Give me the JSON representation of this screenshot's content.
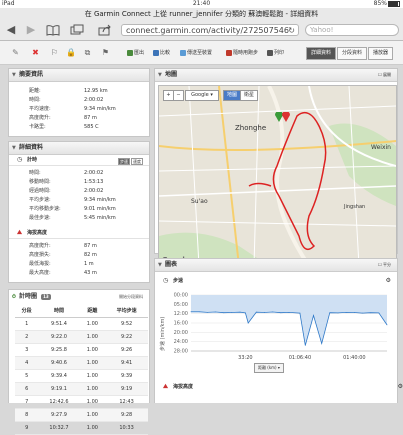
{
  "status": {
    "device": "iPad",
    "time": "21:40",
    "battery": "85%"
  },
  "page_title": "在 Garmin Connect 上從 runner_jennifer 分類的 蘇澳輕鬆跑 - 詳細資料",
  "url": "connect.garmin.com/activity/272507546",
  "search_placeholder": "Yahoo!",
  "toolbar": {
    "export": "匯出",
    "compare": "比較",
    "send_device": "傳送至裝置",
    "garmin_connect": "隨時用跑步",
    "print": "列印",
    "tabs": [
      "詳細資料",
      "分段資料",
      "播放器"
    ]
  },
  "overview": {
    "title": "摘要資訊",
    "rows": [
      {
        "k": "距離:",
        "v": "12.95 km"
      },
      {
        "k": "時間:",
        "v": "2:00:02"
      },
      {
        "k": "平均速度:",
        "v": "9:34 min/km"
      },
      {
        "k": "高度爬升:",
        "v": "87 m"
      },
      {
        "k": "卡路里:",
        "v": "585 C"
      }
    ]
  },
  "details": {
    "title": "詳細資料",
    "timing_title": "計時",
    "timing_opts": [
      "步速",
      "速度"
    ],
    "timing_rows": [
      {
        "k": "時間:",
        "v": "2:00:02"
      },
      {
        "k": "移動時間:",
        "v": "1:53:13"
      },
      {
        "k": "經過時間:",
        "v": "2:00:02"
      },
      {
        "k": "平均步速:",
        "v": "9:34 min/km"
      },
      {
        "k": "平均移動步速:",
        "v": "9:01 min/km"
      },
      {
        "k": "最佳步速:",
        "v": "5:45 min/km"
      }
    ],
    "elev_title": "海拔高度",
    "elev_rows": [
      {
        "k": "高度爬升:",
        "v": "87 m"
      },
      {
        "k": "高度損失:",
        "v": "82 m"
      },
      {
        "k": "最低海拔:",
        "v": "1 m"
      },
      {
        "k": "最大高度:",
        "v": "43 m"
      }
    ]
  },
  "laps": {
    "title": "計時圈",
    "count": "13",
    "link": "開始分段資料",
    "headers": [
      "分段",
      "時間",
      "距離",
      "平均步速"
    ],
    "rows": [
      [
        "1",
        "9:51.4",
        "1.00",
        "9:52"
      ],
      [
        "2",
        "9:22.0",
        "1.00",
        "9:22"
      ],
      [
        "3",
        "9:25.8",
        "1.00",
        "9:26"
      ],
      [
        "4",
        "9:40.6",
        "1.00",
        "9:41"
      ],
      [
        "5",
        "9:39.4",
        "1.00",
        "9:39"
      ],
      [
        "6",
        "9:19.1",
        "1.00",
        "9:19"
      ],
      [
        "7",
        "12:42.6",
        "1.00",
        "12:43"
      ],
      [
        "8",
        "9:27.9",
        "1.00",
        "9:28"
      ],
      [
        "9",
        "10:32.7",
        "1.00",
        "10:33"
      ]
    ]
  },
  "map": {
    "title": "地圖",
    "expand": "展開",
    "provider": "Google",
    "map_btn": "地圖",
    "sat_btn": "衛星",
    "labels": [
      "Zhonghe",
      "Su'ao",
      "Jingshan",
      "Weixin"
    ],
    "footer": "Map data ©2013 Google - Terms of Use"
  },
  "charts": {
    "title": "圖表",
    "lock_label": "平分",
    "pace_title": "步速",
    "yaxis_label": "步速 (min/km)",
    "x_button": "距離 (km)",
    "elev_title": "海拔高度",
    "pace_color": "#2f79c8",
    "chart_data": {
      "type": "line",
      "title": "步速",
      "ylabel": "步速 (min/km)",
      "yticks": [
        "00:00",
        "05:00",
        "12:00",
        "16:00",
        "20:00",
        "24:00",
        "28:00"
      ],
      "xticks": [
        "33:20",
        "01:06:40",
        "01:40:00"
      ],
      "x": [
        0,
        5,
        10,
        15,
        20,
        25,
        30,
        33.3,
        35,
        40,
        45,
        50,
        55,
        60,
        66.7,
        70,
        75,
        80,
        85,
        90,
        95,
        100,
        105,
        110,
        115,
        120
      ],
      "values": [
        9,
        9,
        9.3,
        9.1,
        9.5,
        9.4,
        9.2,
        9.6,
        15,
        9.2,
        9.4,
        9.1,
        9.5,
        9.3,
        9.7,
        27,
        11,
        26,
        9.5,
        9.6,
        9.3,
        9.4,
        9.7,
        9.5,
        9.6,
        16
      ],
      "ylim": [
        0,
        30
      ]
    }
  }
}
